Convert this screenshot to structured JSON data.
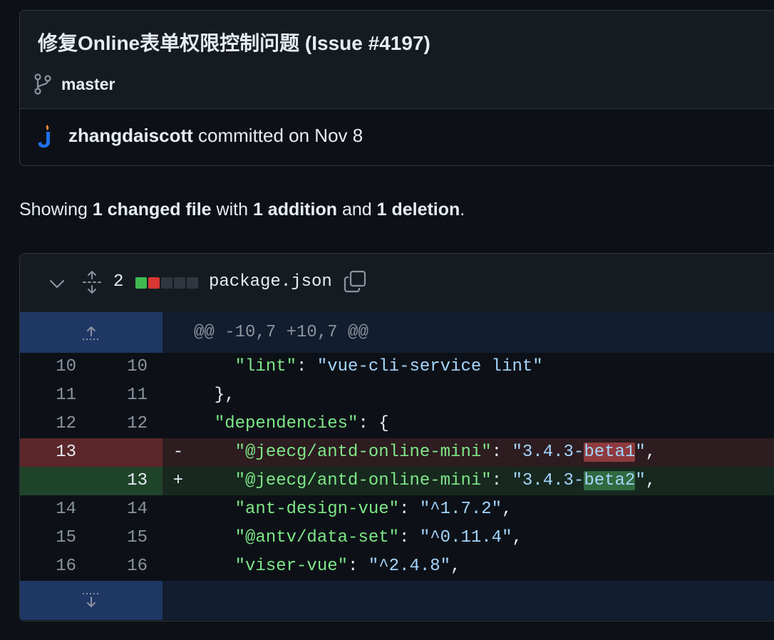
{
  "commit": {
    "title": "修复Online表单权限控制问题 (Issue #4197)",
    "branch": "master",
    "author": "zhangdaiscott",
    "meta": " committed on Nov 8"
  },
  "summary": {
    "prefix": "Showing ",
    "changed": "1 changed file",
    "with": " with ",
    "additions": "1 addition",
    "and": " and ",
    "deletions": "1 deletion",
    "end": "."
  },
  "diff": {
    "count": "2",
    "filename": "package.json",
    "hunk_header": "@@ -10,7 +10,7 @@",
    "diffstat_colors": [
      "#3fb950",
      "#da3633",
      "#30363d",
      "#30363d",
      "#30363d"
    ],
    "lines": [
      {
        "type": "ctx",
        "old": "10",
        "new": "10",
        "sign": "",
        "indent": "    ",
        "key": "\"lint\"",
        "sep": ": ",
        "pre": "\"vue-cli-service lint\"",
        "hl": "",
        "post": "",
        "end": ""
      },
      {
        "type": "ctx",
        "old": "11",
        "new": "11",
        "sign": "",
        "indent": "  },",
        "key": "",
        "sep": "",
        "pre": "",
        "hl": "",
        "post": "",
        "end": ""
      },
      {
        "type": "ctx",
        "old": "12",
        "new": "12",
        "sign": "",
        "indent": "  ",
        "key": "\"dependencies\"",
        "sep": ": {",
        "pre": "",
        "hl": "",
        "post": "",
        "end": ""
      },
      {
        "type": "del",
        "old": "13",
        "new": "",
        "sign": "-",
        "indent": "    ",
        "key": "\"@jeecg/antd-online-mini\"",
        "sep": ": ",
        "pre": "\"3.4.3-",
        "hl": "beta1",
        "post": "\"",
        "end": ","
      },
      {
        "type": "add",
        "old": "",
        "new": "13",
        "sign": "+",
        "indent": "    ",
        "key": "\"@jeecg/antd-online-mini\"",
        "sep": ": ",
        "pre": "\"3.4.3-",
        "hl": "beta2",
        "post": "\"",
        "end": ","
      },
      {
        "type": "ctx",
        "old": "14",
        "new": "14",
        "sign": "",
        "indent": "    ",
        "key": "\"ant-design-vue\"",
        "sep": ": ",
        "pre": "\"^1.7.2\"",
        "hl": "",
        "post": "",
        "end": ","
      },
      {
        "type": "ctx",
        "old": "15",
        "new": "15",
        "sign": "",
        "indent": "    ",
        "key": "\"@antv/data-set\"",
        "sep": ": ",
        "pre": "\"^0.11.4\"",
        "hl": "",
        "post": "",
        "end": ","
      },
      {
        "type": "ctx",
        "old": "16",
        "new": "16",
        "sign": "",
        "indent": "    ",
        "key": "\"viser-vue\"",
        "sep": ": ",
        "pre": "\"^2.4.8\"",
        "hl": "",
        "post": "",
        "end": ","
      }
    ]
  },
  "icons": {
    "branch": "git-branch-icon",
    "avatar": "jeecg-avatar",
    "chevron": "chevron-down-icon",
    "expand_all": "unfold-icon",
    "copy": "copy-icon",
    "expand_up": "expand-up-icon",
    "expand_down": "expand-down-icon"
  }
}
